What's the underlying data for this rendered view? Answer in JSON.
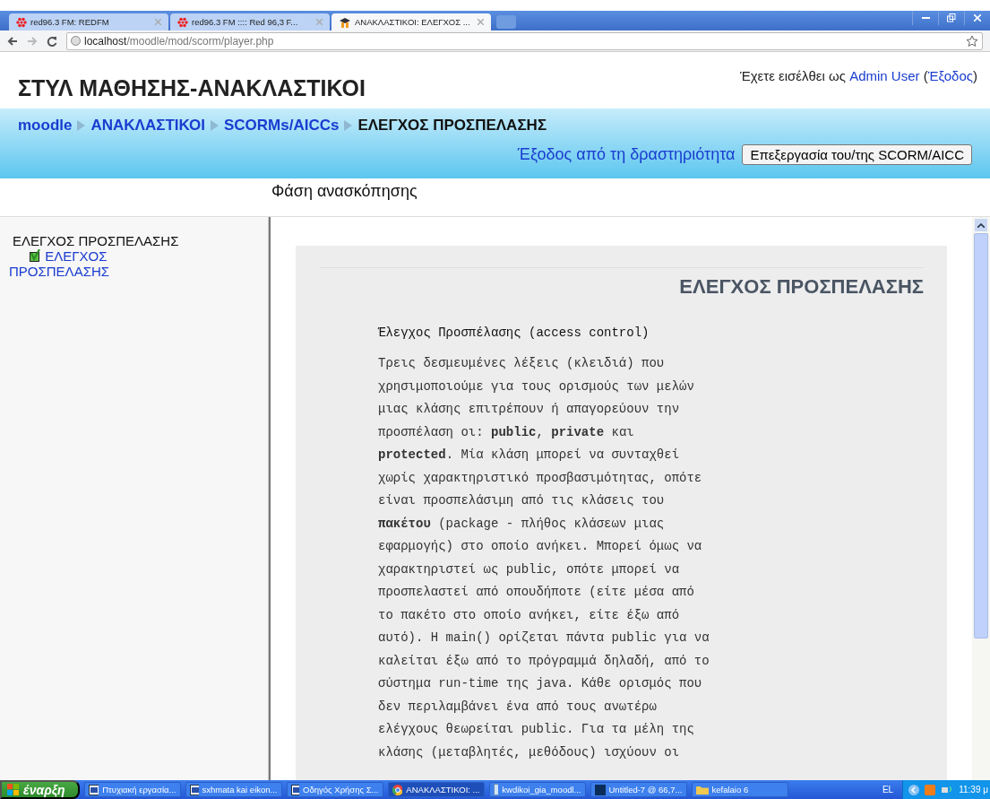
{
  "browser": {
    "tabs": [
      {
        "title": "red96.3 FM: REDFM",
        "kind": "flower",
        "selected": false
      },
      {
        "title": "red96.3 FM :::: Red 96,3 F...",
        "kind": "flower",
        "selected": false
      },
      {
        "title": "ΑΝΑΚΛΑΣΤΙΚΟΙ: ΕΛΕΓΧΟΣ ...",
        "kind": "moodle",
        "selected": true
      }
    ],
    "address": {
      "host": "localhost",
      "path": "/moodle/mod/scorm/player.php"
    }
  },
  "page": {
    "course_title": "ΣΤΥΛ ΜΑΘΗΣΗΣ-ΑΝΑΚΛΑΣΤΙΚΟΙ",
    "login": {
      "prefix": "Έχετε εισέλθει ως",
      "user": "Admin User",
      "open": "(",
      "logout": "Έξοδος",
      "close": ")"
    },
    "breadcrumb": [
      {
        "label": "moodle",
        "link": true
      },
      {
        "label": "ΑΝΑΚΛΑΣΤΙΚΟΙ",
        "link": true
      },
      {
        "label": "SCORMs/AICCs",
        "link": true
      },
      {
        "label": "ΕΛΕΓΧΟΣ ΠΡΟΣΠΕΛΑΣΗΣ",
        "link": false
      }
    ],
    "exit_link": "Έξοδος από τη δραστηριότητα",
    "edit_button": "Επεξεργασία του/της SCORM/AICC",
    "mode": "Φάση ανασκόπησης",
    "toc": {
      "title": "ΕΛΕΓΧΟΣ ΠΡΟΣΠΕΛΑΣΗΣ",
      "items": [
        {
          "label": "ΕΛΕΓΧΟΣ ΠΡΟΣΠΕΛΑΣΗΣ",
          "completed": true
        }
      ]
    },
    "content": {
      "heading": "ΕΛΕΓΧΟΣ ΠΡΟΣΠΕΛΑΣΗΣ",
      "subheading": "Έλεγχος Προσπέλασης (access control)",
      "body": "Τρεις δεσμευμένες λέξεις (κλειδιά) που χρησιμοποιούμε για τους ορισμούς των μελών μιας κλάσης επιτρέπουν ή απαγορεύουν την προσπέλαση οι: **public**, **private** και **protected**. Μία κλάση μπορεί να συνταχθεί χωρίς χαρακτηριστικό προσβασιμότητας, οπότε είναι προσπελάσιμη από τις κλάσεις του **πακέτου** (package - πλήθος κλάσεων μιας εφαρμογής) στο οποίο ανήκει. Μπορεί όμως να χαρακτηριστεί ως public, οπότε μπορεί να προσπελαστεί από οπουδήποτε (είτε μέσα από το πακέτο στο οποίο ανήκει, είτε έξω από αυτό). Η main() ορίζεται πάντα public για να καλείται έξω από το πρόγραμμά δηλαδή, από το σύστημα run-time της java. Κάθε ορισμός που δεν περιλαμβάνει ένα από τους ανωτέρω ελέγχους θεωρείται public. Για τα μέλη της κλάσης (μεταβλητές, μεθόδους) ισχύουν οι"
    }
  },
  "taskbar": {
    "start": "έναρξη",
    "tasks": [
      {
        "label": "Πτυχιακή εργασία...",
        "kind": "word",
        "selected": false
      },
      {
        "label": "sxhmata kai eikon...",
        "kind": "word",
        "selected": false
      },
      {
        "label": "Οδηγός Χρήσης Σ...",
        "kind": "word",
        "selected": false
      },
      {
        "label": "ΑΝΑΚΛΑΣΤΙΚΟΙ: ...",
        "kind": "chrome",
        "selected": true
      },
      {
        "label": "kwdikoi_gia_moodl...",
        "kind": "doc",
        "selected": false
      },
      {
        "label": "Untitled-7 @ 66,7...",
        "kind": "ps",
        "selected": false
      },
      {
        "label": "kefalaio 6",
        "kind": "folder",
        "selected": false
      }
    ],
    "language": "EL",
    "clock": "11:39 μ"
  }
}
